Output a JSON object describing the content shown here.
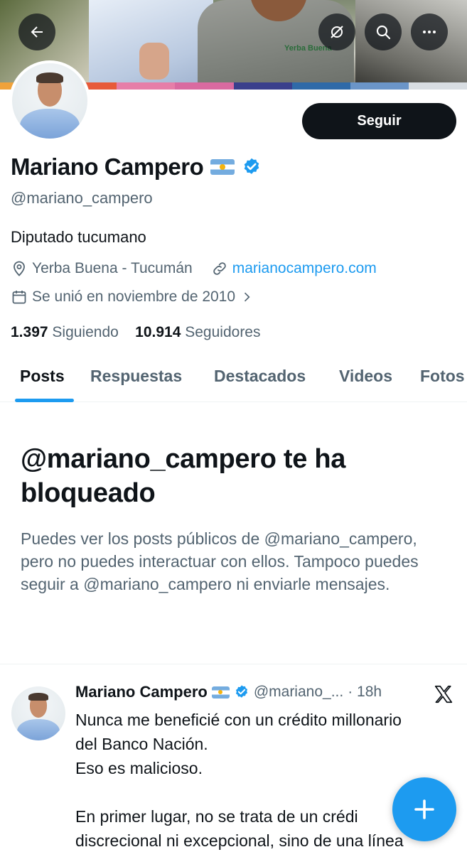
{
  "profile": {
    "name": "Mariano Campero",
    "handle": "@mariano_campero",
    "bio": "Diputado tucumano",
    "location": "Yerba Buena - Tucumán",
    "website": "marianocampero.com",
    "joined": "Se unió en noviembre de 2010",
    "following_count": "1.397",
    "following_label": "Siguiendo",
    "followers_count": "10.914",
    "followers_label": "Seguidores",
    "banner_logo_text": "Yerba Buena"
  },
  "actions": {
    "follow_label": "Seguir"
  },
  "tabs": [
    {
      "label": "Posts",
      "active": true
    },
    {
      "label": "Respuestas",
      "active": false
    },
    {
      "label": "Destacados",
      "active": false
    },
    {
      "label": "Videos",
      "active": false
    },
    {
      "label": "Fotos",
      "active": false
    }
  ],
  "blocked": {
    "title": "@mariano_campero te ha bloqueado",
    "text": "Puedes ver los posts públicos de @mariano_campero, pero no puedes interactuar con ellos. Tampoco puedes seguir a @mariano_campero ni enviarle mensajes."
  },
  "post": {
    "author": "Mariano Campero",
    "handle": "@mariano_...",
    "time": "· 18h",
    "lines": [
      "Nunca me beneficié con un crédito millonario",
      "del Banco Nación.",
      "Eso es malicioso.",
      "",
      "En primer lugar, no se trata de un crédi",
      "discrecional ni excepcional, sino de una línea"
    ]
  },
  "icons": {
    "back": "back-arrow-icon",
    "no_sync": "no-notifications-icon",
    "search": "search-icon",
    "more": "more-icon",
    "verified": "verified-badge-icon",
    "location": "location-pin-icon",
    "link": "link-icon",
    "calendar": "calendar-icon",
    "chevron": "chevron-right-icon",
    "x_logo": "x-logo-icon",
    "compose": "plus-icon"
  },
  "colors": {
    "accent": "#1d9bf0",
    "text_primary": "#0f1419",
    "text_secondary": "#536471",
    "button_dark": "#0f1419",
    "stripe": [
      "#f0a23b",
      "#e75a3a",
      "#e67ea8",
      "#d96aa0",
      "#3a3f8c",
      "#2f6aa8",
      "#6b95c8",
      "#d8dde2"
    ]
  }
}
